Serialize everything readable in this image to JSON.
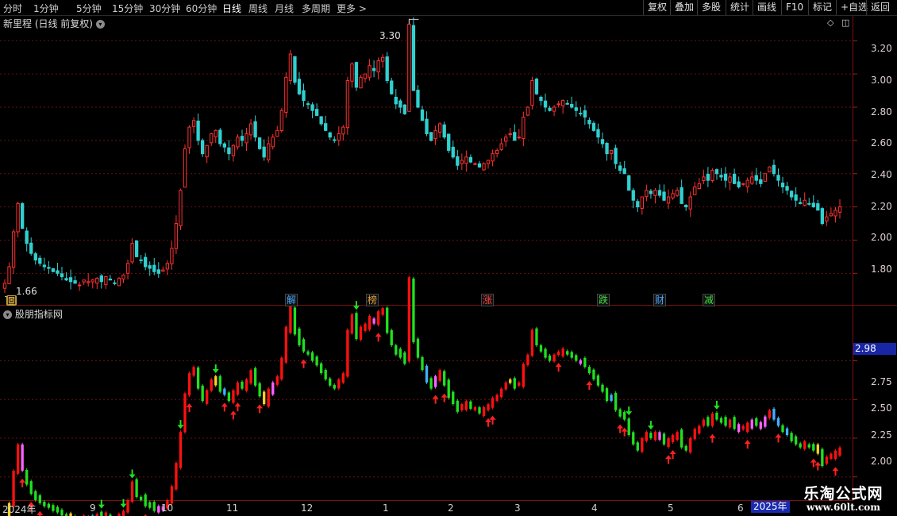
{
  "toolbar": {
    "periods": [
      "分时",
      "1分钟",
      "5分钟",
      "15分钟",
      "30分钟",
      "60分钟",
      "日线",
      "周线",
      "月线",
      "多周期",
      "更多"
    ],
    "active_period": "日线",
    "more_arrow": ">",
    "actions": [
      "复权",
      "叠加",
      "多股",
      "统计",
      "画线",
      "F10",
      "标记",
      "+自选",
      "返回"
    ]
  },
  "price_pane": {
    "title": "新里程 (日线 前复权)",
    "y_ticks": [
      "3.20",
      "3.00",
      "2.80",
      "2.60",
      "2.40",
      "2.20",
      "2.00",
      "1.80"
    ],
    "max_label": "3.30",
    "min_label": "1.66"
  },
  "events": {
    "hui": "回",
    "tags": [
      {
        "text": "解",
        "color": "#4aa8ff"
      },
      {
        "text": "榜",
        "color": "#e0a040"
      },
      {
        "text": "涨",
        "color": "#ff4040"
      },
      {
        "text": "跌",
        "color": "#40e040"
      },
      {
        "text": "财",
        "color": "#4aa8ff"
      },
      {
        "text": "减",
        "color": "#40e040"
      }
    ]
  },
  "indicator_pane": {
    "title": "股朋指标网",
    "y_ticks": [
      "2.75",
      "2.50",
      "2.25",
      "2.00"
    ],
    "current_value": "2.98"
  },
  "date_axis": {
    "labels": [
      "2024年",
      "9",
      "10",
      "11",
      "12",
      "1",
      "2",
      "3",
      "4",
      "5",
      "6"
    ],
    "year_2025": "2025年"
  },
  "watermark": {
    "name": "乐淘公式网",
    "url": "www.60lt.com"
  },
  "colors": {
    "up": "#ff3030",
    "down": "#30d0d0",
    "ind_up": "#ff1010",
    "ind_down": "#20e020",
    "grid": "#6a1010"
  },
  "chart_data": {
    "type": "candlestick",
    "title": "新里程 (日线 前复权)",
    "ylim": [
      1.62,
      3.34
    ],
    "y_ticks": [
      3.2,
      3.0,
      2.8,
      2.6,
      2.4,
      2.2,
      2.0,
      1.8
    ],
    "period_high": 3.3,
    "period_low": 1.66,
    "close_series": [
      1.74,
      1.84,
      2.05,
      2.22,
      2.07,
      1.98,
      1.92,
      1.88,
      1.86,
      1.84,
      1.83,
      1.81,
      1.8,
      1.78,
      1.76,
      1.75,
      1.74,
      1.73,
      1.76,
      1.75,
      1.76,
      1.77,
      1.75,
      1.78,
      1.76,
      1.74,
      1.77,
      1.79,
      1.86,
      1.98,
      1.9,
      1.88,
      1.84,
      1.83,
      1.81,
      1.8,
      1.82,
      1.86,
      1.95,
      2.1,
      2.3,
      2.55,
      2.68,
      2.72,
      2.6,
      2.52,
      2.57,
      2.64,
      2.66,
      2.58,
      2.56,
      2.52,
      2.57,
      2.62,
      2.6,
      2.64,
      2.7,
      2.62,
      2.55,
      2.5,
      2.58,
      2.62,
      2.66,
      2.78,
      2.98,
      3.12,
      2.95,
      2.88,
      2.84,
      2.82,
      2.78,
      2.75,
      2.7,
      2.66,
      2.62,
      2.6,
      2.64,
      2.68,
      2.96,
      3.06,
      2.92,
      2.98,
      3.0,
      3.05,
      3.02,
      3.08,
      3.1,
      2.96,
      2.88,
      2.82,
      2.8,
      2.76,
      3.3,
      2.9,
      2.8,
      2.72,
      2.64,
      2.6,
      2.66,
      2.7,
      2.62,
      2.54,
      2.5,
      2.45,
      2.48,
      2.5,
      2.47,
      2.46,
      2.44,
      2.46,
      2.48,
      2.52,
      2.54,
      2.58,
      2.62,
      2.64,
      2.6,
      2.62,
      2.74,
      2.8,
      2.96,
      2.88,
      2.84,
      2.8,
      2.78,
      2.8,
      2.82,
      2.84,
      2.82,
      2.8,
      2.78,
      2.76,
      2.74,
      2.7,
      2.66,
      2.62,
      2.58,
      2.52,
      2.54,
      2.46,
      2.42,
      2.4,
      2.3,
      2.24,
      2.2,
      2.26,
      2.3,
      2.28,
      2.3,
      2.27,
      2.24,
      2.26,
      2.28,
      2.3,
      2.22,
      2.2,
      2.26,
      2.32,
      2.34,
      2.38,
      2.36,
      2.42,
      2.4,
      2.38,
      2.36,
      2.38,
      2.34,
      2.32,
      2.34,
      2.36,
      2.38,
      2.36,
      2.34,
      2.4,
      2.44,
      2.4,
      2.36,
      2.32,
      2.3,
      2.26,
      2.24,
      2.22,
      2.24,
      2.22,
      2.2,
      2.18,
      2.1,
      2.14,
      2.16,
      2.18,
      2.2
    ]
  }
}
